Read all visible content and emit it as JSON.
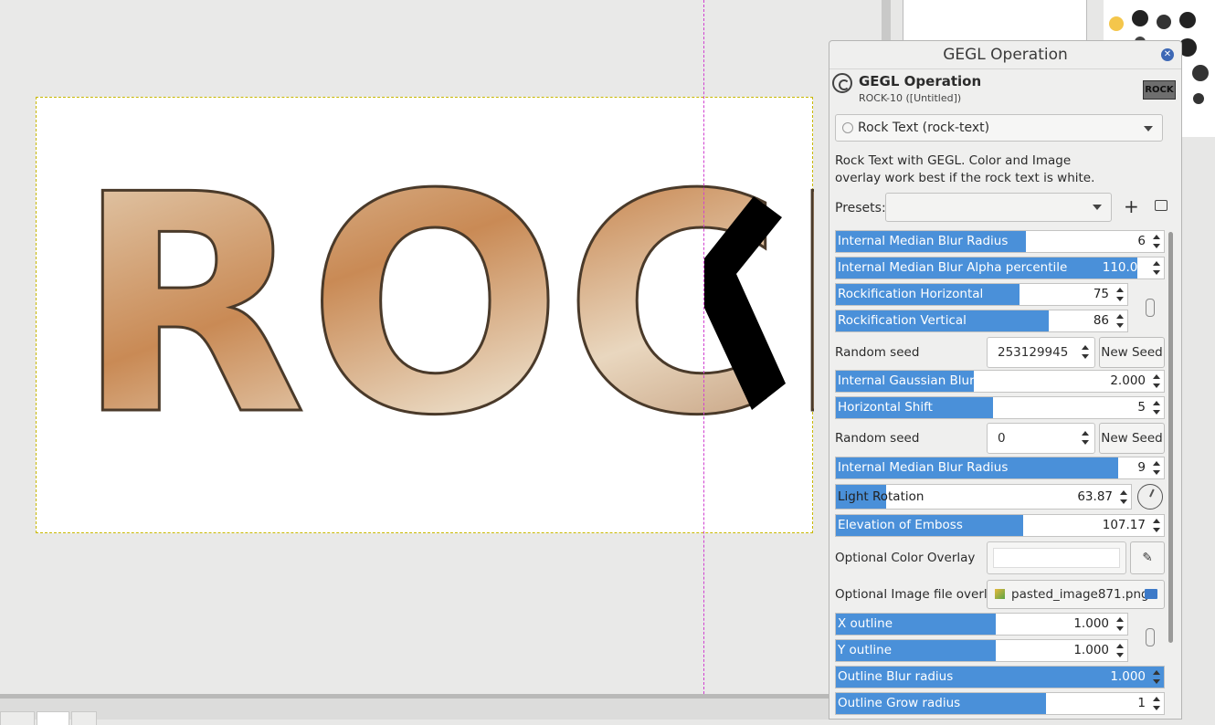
{
  "canvas": {
    "text": "ROCK"
  },
  "dialog": {
    "title": "GEGL Operation",
    "close_icon": "close-icon",
    "header_title": "GEGL Operation",
    "header_subtitle": "ROCK-10 ([Untitled])",
    "thumb_text": "ROCK",
    "operation": "Rock Text (rock-text)",
    "description_line1": "Rock Text with GEGL. Color and Image",
    "description_line2": "overlay work best if the rock text is white.",
    "presets_label": "Presets:",
    "params": {
      "median_blur_radius": {
        "label": "Internal Median Blur Radius",
        "value": "6",
        "fill": 0.58
      },
      "median_blur_alpha": {
        "label": "Internal Median Blur Alpha percentile",
        "value": "110.00",
        "fill": 1.0
      },
      "rock_h": {
        "label": "Rockification Horizontal",
        "value": "75",
        "fill": 0.63
      },
      "rock_v": {
        "label": "Rockification Vertical",
        "value": "86",
        "fill": 0.73
      },
      "seed1_label": "Random seed",
      "seed1_value": "253129945",
      "new_seed": "New Seed",
      "gauss_blur": {
        "label": "Internal Gaussian Blur",
        "value": "2.000",
        "fill": 0.42
      },
      "h_shift": {
        "label": "Horizontal Shift",
        "value": "5",
        "fill": 0.48
      },
      "seed2_label": "Random seed",
      "seed2_value": "0",
      "median_blur_radius2": {
        "label": "Internal Median Blur Radius",
        "value": "9",
        "fill": 0.87
      },
      "light_rotation": {
        "label": "Light Rotation",
        "value": "63.87",
        "fill": 0.17
      },
      "emboss_elev": {
        "label": "Elevation of Emboss",
        "value": "107.17",
        "fill": 0.57
      },
      "color_overlay_label": "Optional Color Overlay",
      "image_overlay_label": "Optional Image file overlay",
      "image_overlay_file": "pasted_image871.png",
      "x_outline": {
        "label": "X outline",
        "value": "1.000",
        "fill": 0.55
      },
      "y_outline": {
        "label": "Y outline",
        "value": "1.000",
        "fill": 0.55
      },
      "outline_blur": {
        "label": "Outline Blur radius",
        "value": "1.000",
        "fill": 1.0
      },
      "outline_grow": {
        "label": "Outline Grow radius",
        "value": "1",
        "fill": 0.6
      }
    }
  },
  "colors": {
    "accent": "#4a90d9",
    "guide": "#d040d0",
    "canvas_border": "#c8b800"
  }
}
